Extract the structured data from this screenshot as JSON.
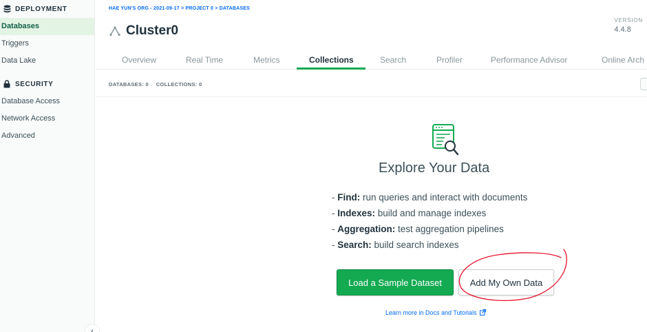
{
  "sidebar": {
    "sections": [
      {
        "label": "DEPLOYMENT",
        "icon": "database-icon"
      },
      {
        "label": "SECURITY",
        "icon": "lock-icon"
      }
    ],
    "deployment_items": [
      "Databases",
      "Triggers",
      "Data Lake"
    ],
    "security_items": [
      "Database Access",
      "Network Access",
      "Advanced"
    ],
    "active_item": "Databases",
    "collapse_icon": "chevron-left-icon"
  },
  "header": {
    "breadcrumb": "HAE YUN'S ORG - 2021-09-17 > PROJECT 0 > DATABASES",
    "title": "Cluster0",
    "title_icon": "cluster-icon",
    "version_label": "VERSION",
    "version_value": "4.4.8"
  },
  "tabs": [
    {
      "label": "Overview"
    },
    {
      "label": "Real Time"
    },
    {
      "label": "Metrics"
    },
    {
      "label": "Collections",
      "active": true
    },
    {
      "label": "Search"
    },
    {
      "label": "Profiler"
    },
    {
      "label": "Performance Advisor"
    },
    {
      "label": "Online Arch"
    }
  ],
  "counts": {
    "databases_label": "DATABASES:",
    "databases_value": "0",
    "collections_label": "COLLECTIONS:",
    "collections_value": "0"
  },
  "explore": {
    "icon": "data-explorer-icon",
    "title": "Explore Your Data",
    "features": [
      {
        "prefix": "- ",
        "name": "Find:",
        "desc": " run queries and interact with documents"
      },
      {
        "prefix": "- ",
        "name": "Indexes:",
        "desc": " build and manage indexes"
      },
      {
        "prefix": "- ",
        "name": "Aggregation:",
        "desc": " test aggregation pipelines"
      },
      {
        "prefix": "- ",
        "name": "Search:",
        "desc": " build search indexes"
      }
    ],
    "load_sample_label": "Load a Sample Dataset",
    "add_own_label": "Add My Own Data",
    "learn_more": "Learn more in Docs and Tutorials",
    "learn_more_icon": "external-link-icon"
  },
  "colors": {
    "accent_green": "#13aa52",
    "link_blue": "#016bf8",
    "annotation_red": "#e8102a"
  }
}
